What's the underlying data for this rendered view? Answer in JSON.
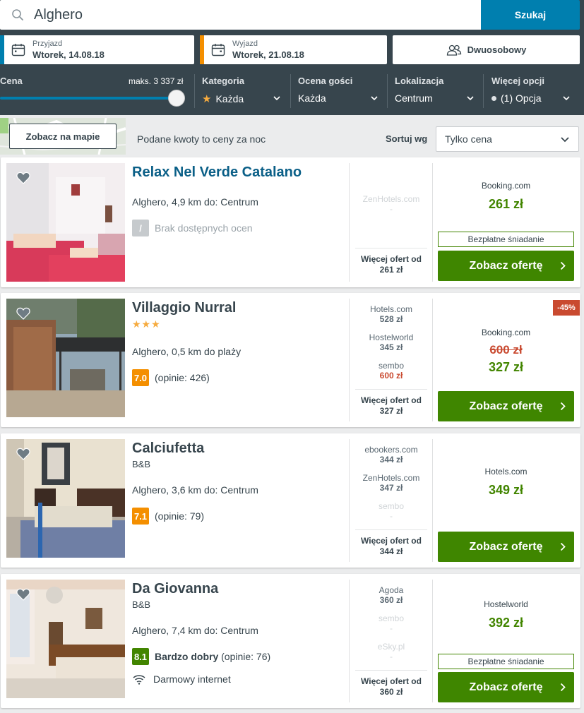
{
  "search": {
    "value": "Alghero",
    "button_label": "Szukaj"
  },
  "checkin": {
    "label": "Przyjazd",
    "value": "Wtorek, 14.08.18"
  },
  "checkout": {
    "label": "Wyjazd",
    "value": "Wtorek, 21.08.18"
  },
  "room": {
    "label": "Dwuosobowy"
  },
  "filters": {
    "price": {
      "label": "Cena",
      "max_label": "maks. 3 337 zł",
      "level": 1.0
    },
    "category": {
      "label": "Kategoria",
      "value": "Każda"
    },
    "rating": {
      "label": "Ocena gości",
      "value": "Każda"
    },
    "location": {
      "label": "Lokalizacja",
      "value": "Centrum"
    },
    "more": {
      "label": "Więcej opcji",
      "value": "(1) Opcja"
    }
  },
  "toolbar": {
    "map_button": "Zobacz na mapie",
    "price_note": "Podane kwoty to ceny za noc",
    "sort_label": "Sortuj wg",
    "sort_value": "Tylko cena"
  },
  "colors": {
    "accent": "#007faf",
    "dark": "#37454d",
    "green": "#3f8600",
    "orange_rating": "#f48f00",
    "green_rating": "#428500",
    "discount": "#c94a30"
  },
  "hotels": [
    {
      "name": "Relax Nel Verde Catalano",
      "location": "Alghero, 4,9 km do: Centrum",
      "rating_badge": "/",
      "rating_text": "Brak dostępnych ocen",
      "deals": [
        {
          "site": "ZenHotels.com",
          "price": "-"
        }
      ],
      "more_label": "Więcej ofert od",
      "more_price": "261 zł",
      "best_site": "Booking.com",
      "best_price": "261 zł",
      "free_label": "Bezpłatne śniadanie",
      "cta": "Zobacz ofertę"
    },
    {
      "name": "Villaggio Nurral",
      "stars": "★★★",
      "location": "Alghero, 0,5 km do plaży",
      "rating_badge": "7.0",
      "rating_text": "(opinie: 426)",
      "deals": [
        {
          "site": "Hotels.com",
          "price": "528 zł"
        },
        {
          "site": "Hostelworld",
          "price": "345 zł"
        },
        {
          "site": "sembo",
          "price": "600 zł"
        }
      ],
      "more_label": "Więcej ofert od",
      "more_price": "327 zł",
      "discount": "-45%",
      "best_site": "Booking.com",
      "old_price": "600 zł",
      "best_price": "327 zł",
      "cta": "Zobacz ofertę"
    },
    {
      "name": "Calciufetta",
      "type": "B&B",
      "location": "Alghero, 3,6 km do: Centrum",
      "rating_badge": "7.1",
      "rating_text": "(opinie: 79)",
      "deals": [
        {
          "site": "ebookers.com",
          "price": "344 zł"
        },
        {
          "site": "ZenHotels.com",
          "price": "347 zł"
        },
        {
          "site": "sembo",
          "price": "-"
        }
      ],
      "more_label": "Więcej ofert od",
      "more_price": "344 zł",
      "best_site": "Hotels.com",
      "best_price": "349 zł",
      "cta": "Zobacz ofertę"
    },
    {
      "name": "Da Giovanna",
      "type": "B&B",
      "location": "Alghero, 7,4 km do: Centrum",
      "rating_badge": "8.1",
      "rating_word": "Bardzo dobry",
      "rating_text": "(opinie: 76)",
      "amenity": "Darmowy internet",
      "deals": [
        {
          "site": "Agoda",
          "price": "360 zł"
        },
        {
          "site": "sembo",
          "price": "-"
        },
        {
          "site": "eSky.pl",
          "price": "-"
        }
      ],
      "more_label": "Więcej ofert od",
      "more_price": "360 zł",
      "best_site": "Hostelworld",
      "best_price": "392 zł",
      "free_label": "Bezpłatne śniadanie",
      "cta": "Zobacz ofertę"
    }
  ]
}
